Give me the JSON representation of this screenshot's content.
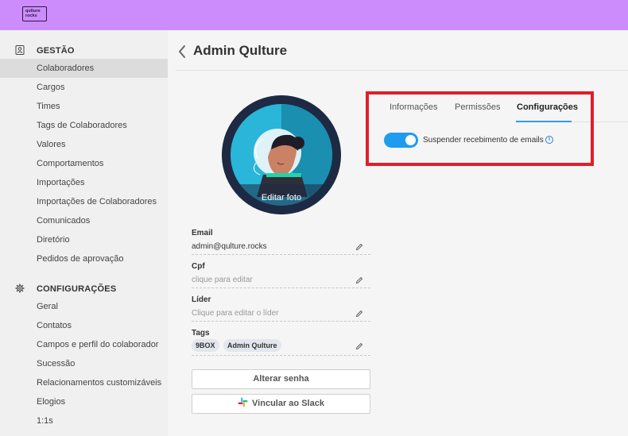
{
  "header": {
    "logo_line1": "qulture",
    "logo_line2": "rocks",
    "accent_color": "#cc8cfb"
  },
  "sidebar": {
    "gestao": {
      "title": "GESTÃO",
      "icon": "id-card-icon",
      "items": [
        {
          "label": "Colaboradores",
          "active": true
        },
        {
          "label": "Cargos"
        },
        {
          "label": "Times"
        },
        {
          "label": "Tags de Colaboradores"
        },
        {
          "label": "Valores"
        },
        {
          "label": "Comportamentos"
        },
        {
          "label": "Importações"
        },
        {
          "label": "Importações de Colaboradores"
        },
        {
          "label": "Comunicados"
        },
        {
          "label": "Diretório"
        },
        {
          "label": "Pedidos de aprovação"
        }
      ]
    },
    "config": {
      "title": "CONFIGURAÇÕES",
      "icon": "gear-icon",
      "items": [
        {
          "label": "Geral"
        },
        {
          "label": "Contatos"
        },
        {
          "label": "Campos e perfil do colaborador"
        },
        {
          "label": "Sucessão"
        },
        {
          "label": "Relacionamentos customizáveis"
        },
        {
          "label": "Elogios"
        },
        {
          "label": "1:1s"
        }
      ]
    }
  },
  "main": {
    "title": "Admin Qulture",
    "edit_photo": "Editar foto",
    "fields": {
      "email": {
        "label": "Email",
        "value": "admin@qulture.rocks"
      },
      "cpf": {
        "label": "Cpf",
        "placeholder": "clique para editar"
      },
      "lider": {
        "label": "Líder",
        "placeholder": "Clique para editar o líder"
      },
      "tags": {
        "label": "Tags",
        "items": [
          "9BOX",
          "Admin Qulture"
        ]
      }
    },
    "buttons": {
      "change_password": "Alterar senha",
      "slack": "Vincular ao Slack"
    },
    "tabs": [
      {
        "label": "Informações"
      },
      {
        "label": "Permissões"
      },
      {
        "label": "Configurações",
        "active": true
      }
    ],
    "settings": {
      "suspend_emails": {
        "label": "Suspender recebimento de emails",
        "enabled": true
      },
      "info_symbol": "i"
    },
    "highlight_color": "#e01e2b",
    "toggle_color": "#1e9cf0"
  }
}
